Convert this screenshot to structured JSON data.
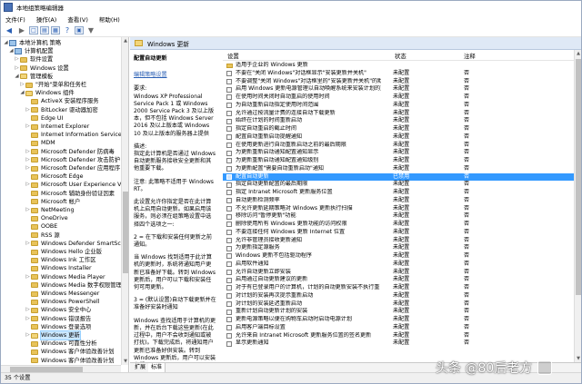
{
  "window": {
    "title": "本地组策略编辑器"
  },
  "menu": [
    "文件(F)",
    "操作(A)",
    "查看(V)",
    "帮助(H)"
  ],
  "tree": [
    {
      "label": "本地计算机 策略",
      "level": 0,
      "exp": "v",
      "icon": "pc"
    },
    {
      "label": "计算机配置",
      "level": 1,
      "exp": "v",
      "icon": "pc"
    },
    {
      "label": "软件设置",
      "level": 2,
      "exp": ">",
      "icon": "folder"
    },
    {
      "label": "Windows 设置",
      "level": 2,
      "exp": ">",
      "icon": "folder"
    },
    {
      "label": "管理模板",
      "level": 2,
      "exp": "v",
      "icon": "folder-open"
    },
    {
      "label": "\"开始\"菜单和任务栏",
      "level": 3,
      "exp": ">",
      "icon": "folder"
    },
    {
      "label": "Windows 组件",
      "level": 3,
      "exp": "v",
      "icon": "folder-open"
    },
    {
      "label": "ActiveX 安装程序服务",
      "level": 4,
      "exp": "",
      "icon": "folder"
    },
    {
      "label": "BitLocker 驱动器加密",
      "level": 4,
      "exp": ">",
      "icon": "folder"
    },
    {
      "label": "Edge UI",
      "level": 4,
      "exp": "",
      "icon": "folder"
    },
    {
      "label": "Internet Explorer",
      "level": 4,
      "exp": ">",
      "icon": "folder"
    },
    {
      "label": "Internet Information Services",
      "level": 4,
      "exp": "",
      "icon": "folder"
    },
    {
      "label": "MDM",
      "level": 4,
      "exp": "",
      "icon": "folder"
    },
    {
      "label": "Microsoft Defender 防病毒",
      "level": 4,
      "exp": ">",
      "icon": "folder"
    },
    {
      "label": "Microsoft Defender 攻击防护",
      "level": 4,
      "exp": ">",
      "icon": "folder"
    },
    {
      "label": "Microsoft Defender 应用程序",
      "level": 4,
      "exp": ">",
      "icon": "folder"
    },
    {
      "label": "Microsoft Edge",
      "level": 4,
      "exp": "",
      "icon": "folder"
    },
    {
      "label": "Microsoft User Experience Vir",
      "level": 4,
      "exp": ">",
      "icon": "folder"
    },
    {
      "label": "Microsoft 辅助身份验证因素",
      "level": 4,
      "exp": "",
      "icon": "folder"
    },
    {
      "label": "Microsoft 帐户",
      "level": 4,
      "exp": "",
      "icon": "folder"
    },
    {
      "label": "NetMeeting",
      "level": 4,
      "exp": ">",
      "icon": "folder"
    },
    {
      "label": "OneDrive",
      "level": 4,
      "exp": "",
      "icon": "folder"
    },
    {
      "label": "OOBE",
      "level": 4,
      "exp": "",
      "icon": "folder"
    },
    {
      "label": "RSS 源",
      "level": 4,
      "exp": "",
      "icon": "folder"
    },
    {
      "label": "Windows Defender SmartScre",
      "level": 4,
      "exp": ">",
      "icon": "folder"
    },
    {
      "label": "Windows Hello 企业版",
      "level": 4,
      "exp": "",
      "icon": "folder"
    },
    {
      "label": "Windows Ink 工作区",
      "level": 4,
      "exp": "",
      "icon": "folder"
    },
    {
      "label": "Windows Installer",
      "level": 4,
      "exp": "",
      "icon": "folder"
    },
    {
      "label": "Windows Media Player",
      "level": 4,
      "exp": ">",
      "icon": "folder"
    },
    {
      "label": "Windows Media 数字权限管理",
      "level": 4,
      "exp": "",
      "icon": "folder"
    },
    {
      "label": "Windows Messenger",
      "level": 4,
      "exp": "",
      "icon": "folder"
    },
    {
      "label": "Windows PowerShell",
      "level": 4,
      "exp": "",
      "icon": "folder"
    },
    {
      "label": "Windows 安全中心",
      "level": 4,
      "exp": ">",
      "icon": "folder"
    },
    {
      "label": "Windows 错误报告",
      "level": 4,
      "exp": ">",
      "icon": "folder"
    },
    {
      "label": "Windows 登录选项",
      "level": 4,
      "exp": "",
      "icon": "folder"
    },
    {
      "label": "Windows 更新",
      "level": 4,
      "exp": ">",
      "icon": "folder-open",
      "selected": true
    },
    {
      "label": "Windows 可靠性分析",
      "level": 4,
      "exp": "",
      "icon": "folder"
    },
    {
      "label": "Windows 客户体验改善计划",
      "level": 4,
      "exp": "",
      "icon": "folder"
    },
    {
      "label": "Windows 客户体验改善计划",
      "level": 4,
      "exp": "",
      "icon": "folder"
    }
  ],
  "detail_header": "Windows 更新",
  "description": {
    "title": "配置自动更新",
    "edit_link": "编辑策略设置",
    "paragraphs": [
      "要求:\nWindows XP Professional Service Pack 1 或 Windows 2000 Service Pack 3 及以上版本，但不包括 Windows Server 2016 及以上版本或 Windows 10 及以上版本的服务器上提供",
      "描述:\n指定此计算机是否通过 Windows 自动更新服务接收安全更新和其他重要下载。",
      "注意: 此策略不适用于 Windows RT。",
      "此设置允许你指定是否在此计算机上启用自动更新。如果启用该服务，则必须在组策略设置中选择四个选项之一:",
      "2 = 在下载和安装任何更新之前通知。",
      "当 Windows 找到适用于此计算机的更新时，系统将通知用户更新已准备好下载。转到 Windows 更新后，用户可以下载和安装任何可用更新。",
      "3 = (默认设置)自动下载更新并在准备好安装时通知",
      "Windows 查找适用于计算机的更新，并在后台下载这些更新(在此过程中，用户不会收到通知或被打扰)。下载完成后，将通知用户更新已准备好供安装。转到 Windows 更新后，用户可以安装它们。"
    ]
  },
  "list_headers": {
    "name": "设置",
    "state": "状态",
    "comment": "注释"
  },
  "settings": [
    {
      "name": "适用于企业的 Windows 更新",
      "state": "",
      "comment": "",
      "type": "folder"
    },
    {
      "name": "不要在\"关闭 Windows\"对话框显示\"安装更新并关机\"",
      "state": "未配置",
      "comment": "否"
    },
    {
      "name": "不要调整\"关闭 Windows\"对话框里的\"安装更新并关机\"的默",
      "state": "未配置",
      "comment": "否"
    },
    {
      "name": "启用 Windows 更新电源管理以自动唤醒系统来安装计划的更",
      "state": "未配置",
      "comment": "否"
    },
    {
      "name": "在使用时间关闭时自动重启的使用时间",
      "state": "未配置",
      "comment": "否"
    },
    {
      "name": "为自动重新启动指定使用时间范围",
      "state": "未配置",
      "comment": "否"
    },
    {
      "name": "允许通过按流量计费的连接自动下载更新",
      "state": "未配置",
      "comment": "否"
    },
    {
      "name": "始终在计划的时间重新启动",
      "state": "未配置",
      "comment": "否"
    },
    {
      "name": "指定自动重启的截止时间",
      "state": "未配置",
      "comment": "否"
    },
    {
      "name": "配置自动重新启动提醒通知",
      "state": "未配置",
      "comment": "否"
    },
    {
      "name": "在使用更新进行自动重新启动之前的最后期限",
      "state": "未配置",
      "comment": "否"
    },
    {
      "name": "为更新重新启动通知配置通知显示",
      "state": "未配置",
      "comment": "否"
    },
    {
      "name": "为更新重新启动通知配置通知级别",
      "state": "未配置",
      "comment": "否"
    },
    {
      "name": "为更新配置\"需要自动重新启动\"通知",
      "state": "未配置",
      "comment": "否"
    },
    {
      "name": "配置自动更新",
      "state": "已禁用",
      "comment": "否",
      "selected": true
    },
    {
      "name": "指定自动更新配置的最后期限",
      "state": "未配置",
      "comment": "否"
    },
    {
      "name": "指定 Intranet Microsoft 更新服务位置",
      "state": "未配置",
      "comment": "否"
    },
    {
      "name": "自动更新检测频率",
      "state": "未配置",
      "comment": "否"
    },
    {
      "name": "不允许更新延期策略对 Windows 更新执行扫描",
      "state": "未配置",
      "comment": "否"
    },
    {
      "name": "移除访问\"暂停更新\"功能",
      "state": "未配置",
      "comment": "否"
    },
    {
      "name": "删除使用所有 Windows 更新功能的访问权限",
      "state": "未配置",
      "comment": "否"
    },
    {
      "name": "不要连接任何 Windows 更新 Internet 位置",
      "state": "未配置",
      "comment": "否"
    },
    {
      "name": "允许非管理员接收更新通知",
      "state": "未配置",
      "comment": "否"
    },
    {
      "name": "为更新指定源服务",
      "state": "未配置",
      "comment": "否"
    },
    {
      "name": "Windows 更新不包括驱动程序",
      "state": "未配置",
      "comment": "否"
    },
    {
      "name": "启用软件通知",
      "state": "未配置",
      "comment": "否"
    },
    {
      "name": "允许自动更新立即安装",
      "state": "未配置",
      "comment": "否"
    },
    {
      "name": "启用通过自动更新建议的更新",
      "state": "未配置",
      "comment": "否"
    },
    {
      "name": "对于有已登录用户的计算机，计划的自动更新安装不执行重",
      "state": "未配置",
      "comment": "否"
    },
    {
      "name": "对计划的安装再次提示重新启动",
      "state": "未配置",
      "comment": "否"
    },
    {
      "name": "对计划的安装延迟重新启动",
      "state": "未配置",
      "comment": "否"
    },
    {
      "name": "重新计划自动更新计划的安装",
      "state": "未配置",
      "comment": "否"
    },
    {
      "name": "更新电源策略以便在购物车启动时启动电源计划",
      "state": "未配置",
      "comment": "否"
    },
    {
      "name": "启用客户端目标设置",
      "state": "未配置",
      "comment": "否"
    },
    {
      "name": "允许来自 Intranet Microsoft 更新服务位置的签名更新",
      "state": "未配置",
      "comment": "否"
    },
    {
      "name": "显示更新通知",
      "state": "未配置",
      "comment": "否"
    }
  ],
  "tabs": [
    "扩展",
    "标准"
  ],
  "status": "35 个设置",
  "watermark": "头条 @80后老方"
}
